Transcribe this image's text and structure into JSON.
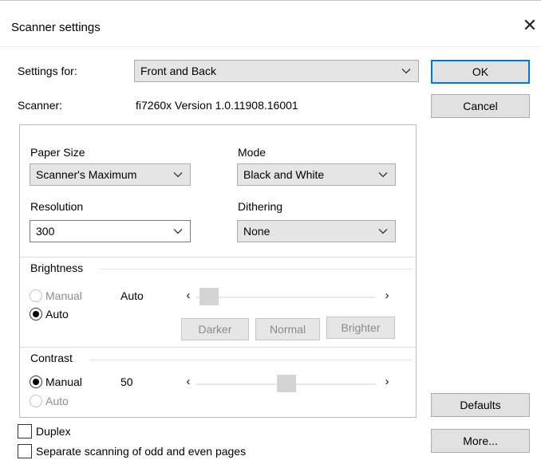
{
  "window": {
    "title": "Scanner settings",
    "close_glyph": "✕"
  },
  "settings_for": {
    "label": "Settings for:",
    "value": "Front and Back"
  },
  "scanner": {
    "label": "Scanner:",
    "value": "fi7260x Version 1.0.11908.16001"
  },
  "buttons": {
    "ok": "OK",
    "cancel": "Cancel",
    "defaults": "Defaults",
    "more": "More..."
  },
  "paper_size": {
    "label": "Paper Size",
    "value": "Scanner's Maximum"
  },
  "mode": {
    "label": "Mode",
    "value": "Black and White"
  },
  "resolution": {
    "label": "Resolution",
    "value": "300"
  },
  "dithering": {
    "label": "Dithering",
    "value": "None"
  },
  "brightness": {
    "label": "Brightness",
    "manual_label": "Manual",
    "auto_label": "Auto",
    "selected": "Auto",
    "value_text": "Auto",
    "level": 0.0,
    "darker": "Darker",
    "normal": "Normal",
    "brighter": "Brighter"
  },
  "contrast": {
    "label": "Contrast",
    "manual_label": "Manual",
    "auto_label": "Auto",
    "selected": "Manual",
    "value_text": "50",
    "level": 0.5
  },
  "checkboxes": {
    "duplex": {
      "label": "Duplex",
      "checked": false
    },
    "separate": {
      "label": "Separate scanning of odd and even pages",
      "checked": false
    }
  },
  "colors": {
    "accent": "#0078d7",
    "disabled_text": "#8c8c8c"
  }
}
